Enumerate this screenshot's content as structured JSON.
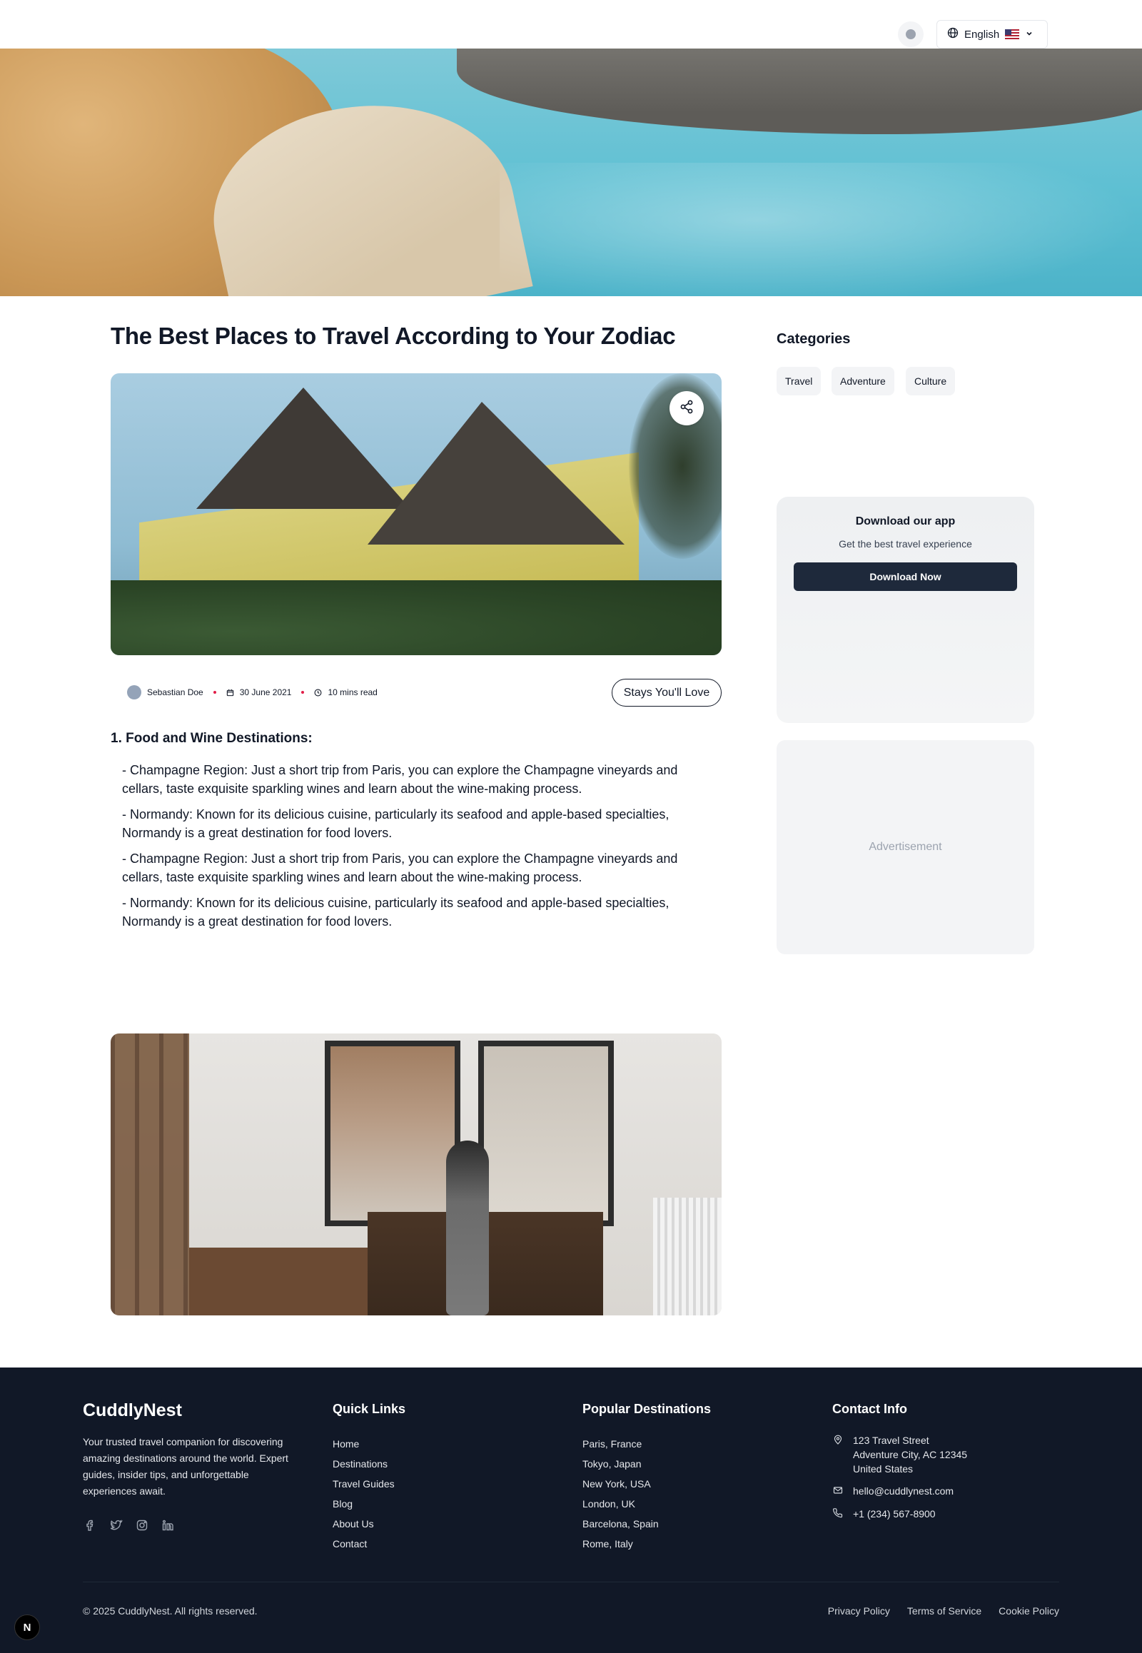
{
  "header": {
    "language_label": "English",
    "language_flag_icon": "us-flag-icon",
    "icons": [
      "globe-icon",
      "chevron-down-icon",
      "user-avatar"
    ]
  },
  "article": {
    "title": "The Best Places to Travel According to Your Zodiac",
    "author": "Sebastian Doe",
    "date": "30 June 2021",
    "read_time": "10 mins read",
    "stays_button": "Stays You'll Love",
    "section_heading": "1. Food and Wine Destinations:",
    "paragraphs": [
      "- Champagne Region: Just a short trip from Paris, you can explore the Champagne vineyards and cellars, taste exquisite sparkling wines and learn about the wine-making process.",
      "- Normandy: Known for its delicious cuisine, particularly its seafood and apple-based specialties, Normandy is a great destination for food lovers.",
      "- Champagne Region: Just a short trip from Paris, you can explore the Champagne vineyards and cellars, taste exquisite sparkling wines and learn about the wine-making process.",
      "- Normandy: Known for its delicious cuisine, particularly its seafood and apple-based specialties, Normandy is a great destination for food lovers."
    ]
  },
  "sidebar": {
    "categories_heading": "Categories",
    "categories": [
      "Travel",
      "Adventure",
      "Culture"
    ],
    "app_card": {
      "heading": "Download our app",
      "subtitle": "Get the best travel experience",
      "button": "Download Now"
    },
    "ad_label": "Advertisement"
  },
  "footer": {
    "brand": "CuddlyNest",
    "description": "Your trusted travel companion for discovering amazing destinations around the world. Expert guides, insider tips, and unforgettable experiences await.",
    "social_icons": [
      "facebook-icon",
      "twitter-icon",
      "instagram-icon",
      "linkedin-icon"
    ],
    "quick_links_heading": "Quick Links",
    "quick_links": [
      "Home",
      "Destinations",
      "Travel Guides",
      "Blog",
      "About Us",
      "Contact"
    ],
    "destinations_heading": "Popular Destinations",
    "destinations": [
      "Paris, France",
      "Tokyo, Japan",
      "New York, USA",
      "London, UK",
      "Barcelona, Spain",
      "Rome, Italy"
    ],
    "contact_heading": "Contact Info",
    "address_lines": [
      "123 Travel Street",
      "Adventure City, AC 12345",
      "United States"
    ],
    "email": "hello@cuddlynest.com",
    "phone": "+1 (234) 567-8900",
    "copyright": "© 2025 CuddlyNest. All rights reserved.",
    "legal_links": [
      "Privacy Policy",
      "Terms of Service",
      "Cookie Policy"
    ]
  },
  "dev_badge": "N"
}
